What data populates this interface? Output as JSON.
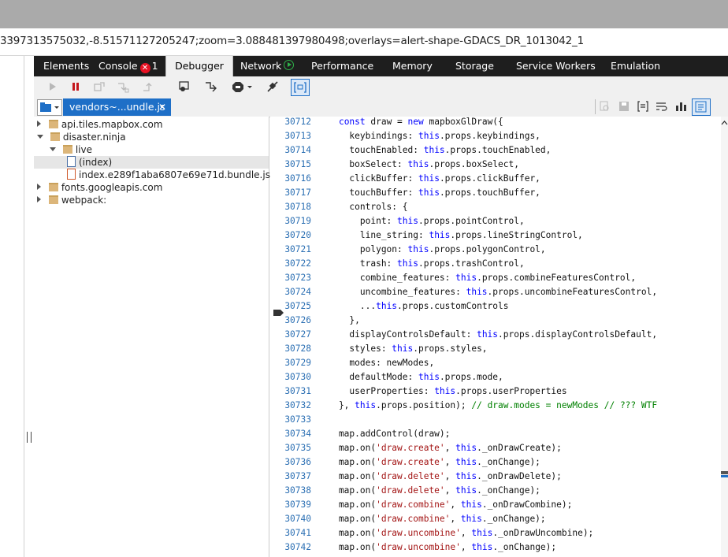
{
  "address_bar": {
    "url_text": "3397313575032,-8.51571127205247;zoom=3.088481397980498;overlays=alert-shape-GDACS_DR_1013042_1"
  },
  "devtools_tabs": [
    {
      "label": "Elements"
    },
    {
      "label": "Console",
      "badge": "1"
    },
    {
      "label": "Debugger"
    },
    {
      "label": "Network"
    },
    {
      "label": "Performance"
    },
    {
      "label": "Memory"
    },
    {
      "label": "Storage"
    },
    {
      "label": "Service Workers"
    },
    {
      "label": "Emulation"
    }
  ],
  "active_tab": "Debugger",
  "toolbar_icons": [
    "play-icon",
    "pause-icon",
    "step-over-icon",
    "step-into-icon",
    "step-out-icon",
    "break-on-new-worker-icon",
    "exception-behavior-icon",
    "disable-breakpoints-icon",
    "pretty-print-icon"
  ],
  "file_tab": {
    "label": "vendors~...undle.js",
    "close": "✕"
  },
  "tree": [
    {
      "label": "api.tiles.mapbox.com",
      "type": "folder",
      "state": "closed",
      "level": 0
    },
    {
      "label": "disaster.ninja",
      "type": "folder",
      "state": "open",
      "level": 0
    },
    {
      "label": "live",
      "type": "folder",
      "state": "open",
      "level": 1
    },
    {
      "label": "(index)",
      "type": "file",
      "level": 2,
      "selected": true
    },
    {
      "label": "index.e289f1aba6807e69e71d.bundle.js",
      "type": "js",
      "level": 2
    },
    {
      "label": "fonts.googleapis.com",
      "type": "folder",
      "state": "closed",
      "level": 0
    },
    {
      "label": "webpack:",
      "type": "folder",
      "state": "closed",
      "level": 0
    }
  ],
  "code_lines": [
    {
      "num": "30712",
      "html": "    <span class=\"kw\">const</span> draw = <span class=\"kw\">new</span> mapboxGlDraw({"
    },
    {
      "num": "30713",
      "html": "      keybindings: <span class=\"kw\">this</span>.props.keybindings,"
    },
    {
      "num": "30714",
      "html": "      touchEnabled: <span class=\"kw\">this</span>.props.touchEnabled,"
    },
    {
      "num": "30715",
      "html": "      boxSelect: <span class=\"kw\">this</span>.props.boxSelect,"
    },
    {
      "num": "30716",
      "html": "      clickBuffer: <span class=\"kw\">this</span>.props.clickBuffer,"
    },
    {
      "num": "30717",
      "html": "      touchBuffer: <span class=\"kw\">this</span>.props.touchBuffer,"
    },
    {
      "num": "30718",
      "html": "      controls: {"
    },
    {
      "num": "30719",
      "html": "        point: <span class=\"kw\">this</span>.props.pointControl,"
    },
    {
      "num": "30720",
      "html": "        line_string: <span class=\"kw\">this</span>.props.lineStringControl,"
    },
    {
      "num": "30721",
      "html": "        polygon: <span class=\"kw\">this</span>.props.polygonControl,"
    },
    {
      "num": "30722",
      "html": "        trash: <span class=\"kw\">this</span>.props.trashControl,"
    },
    {
      "num": "30723",
      "html": "        combine_features: <span class=\"kw\">this</span>.props.combineFeaturesControl,"
    },
    {
      "num": "30724",
      "html": "        uncombine_features: <span class=\"kw\">this</span>.props.uncombineFeaturesControl,"
    },
    {
      "num": "30725",
      "html": "        ...<span class=\"kw\">this</span>.props.customControls"
    },
    {
      "num": "30726",
      "html": "      },"
    },
    {
      "num": "30727",
      "html": "      displayControlsDefault: <span class=\"kw\">this</span>.props.displayControlsDefault,"
    },
    {
      "num": "30728",
      "html": "      styles: <span class=\"kw\">this</span>.props.styles,"
    },
    {
      "num": "30729",
      "html": "      modes: newModes,"
    },
    {
      "num": "30730",
      "html": "      defaultMode: <span class=\"kw\">this</span>.props.mode,"
    },
    {
      "num": "30731",
      "html": "      userProperties: <span class=\"kw\">this</span>.props.userProperties"
    },
    {
      "num": "30732",
      "html": "    }, <span class=\"kw\">this</span>.props.position); <span class=\"cm\">// draw.modes = newModes // ??? WTF</span>"
    },
    {
      "num": "30733",
      "html": ""
    },
    {
      "num": "30734",
      "html": "    map.addControl(draw);"
    },
    {
      "num": "30735",
      "html": "    map.on(<span class=\"str\">'draw.create'</span>, <span class=\"kw\">this</span>._onDrawCreate);"
    },
    {
      "num": "30736",
      "html": "    map.on(<span class=\"str\">'draw.create'</span>, <span class=\"kw\">this</span>._onChange);"
    },
    {
      "num": "30737",
      "html": "    map.on(<span class=\"str\">'draw.delete'</span>, <span class=\"kw\">this</span>._onDrawDelete);"
    },
    {
      "num": "30738",
      "html": "    map.on(<span class=\"str\">'draw.delete'</span>, <span class=\"kw\">this</span>._onChange);"
    },
    {
      "num": "30739",
      "html": "    map.on(<span class=\"str\">'draw.combine'</span>, <span class=\"kw\">this</span>._onDrawCombine);"
    },
    {
      "num": "30740",
      "html": "    map.on(<span class=\"str\">'draw.combine'</span>, <span class=\"kw\">this</span>._onChange);"
    },
    {
      "num": "30741",
      "html": "    map.on(<span class=\"str\">'draw.uncombine'</span>, <span class=\"kw\">this</span>._onDrawUncombine);"
    },
    {
      "num": "30742",
      "html": "    map.on(<span class=\"str\">'draw.uncombine'</span>, <span class=\"kw\">this</span>._onChange);"
    }
  ],
  "current_line": "30725",
  "colors": {
    "tabs_bg": "#1e1e1e",
    "file_tab_bg": "#1e6fc7",
    "line_number": "#2b6fb3",
    "keyword": "#0000ff",
    "string": "#a31515",
    "comment": "#008000"
  }
}
